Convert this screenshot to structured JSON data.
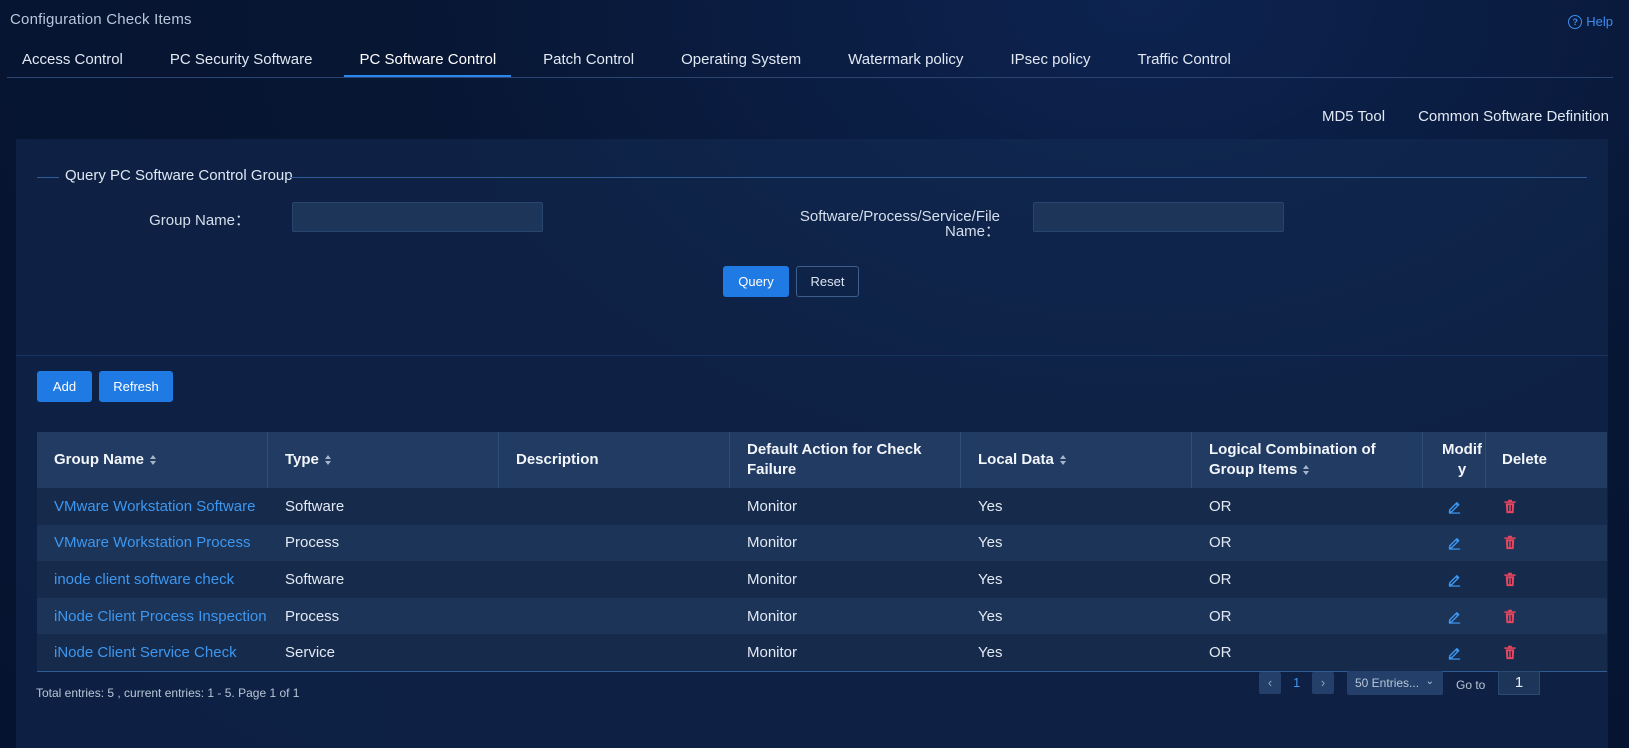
{
  "page": {
    "title": "Configuration Check Items",
    "help_label": "Help"
  },
  "tabs": [
    {
      "label": "Access Control"
    },
    {
      "label": "PC Security Software"
    },
    {
      "label": "PC Software Control",
      "active": true
    },
    {
      "label": "Patch Control"
    },
    {
      "label": "Operating System"
    },
    {
      "label": "Watermark policy"
    },
    {
      "label": "IPsec policy"
    },
    {
      "label": "Traffic Control"
    }
  ],
  "toplinks": {
    "md5_tool": "MD5 Tool",
    "common_software": "Common Software Definition"
  },
  "query": {
    "title": "Query PC Software Control Group",
    "group_name_label": "Group Name：",
    "group_name_value": "",
    "software_label_line1": "Software/Process/Service/File",
    "software_label_line2": "Name：",
    "software_value": "",
    "query_button": "Query",
    "reset_button": "Reset"
  },
  "actions": {
    "add": "Add",
    "refresh": "Refresh"
  },
  "table": {
    "headers": {
      "group_name": "Group Name",
      "type": "Type",
      "description": "Description",
      "default_action": "Default Action for Check Failure",
      "local_data": "Local Data",
      "logical": "Logical Combination of Group Items",
      "modify": "Modify",
      "delete": "Delete"
    },
    "rows": [
      {
        "group_name": "VMware Workstation Software",
        "type": "Software",
        "description": "",
        "default_action": "Monitor",
        "local_data": "Yes",
        "logical": "OR"
      },
      {
        "group_name": "VMware Workstation Process",
        "type": "Process",
        "description": "",
        "default_action": "Monitor",
        "local_data": "Yes",
        "logical": "OR"
      },
      {
        "group_name": "inode client software check",
        "type": "Software",
        "description": "",
        "default_action": "Monitor",
        "local_data": "Yes",
        "logical": "OR"
      },
      {
        "group_name": "iNode Client Process Inspection",
        "type": "Process",
        "description": "",
        "default_action": "Monitor",
        "local_data": "Yes",
        "logical": "OR"
      },
      {
        "group_name": "iNode Client Service Check",
        "type": "Service",
        "description": "",
        "default_action": "Monitor",
        "local_data": "Yes",
        "logical": "OR"
      }
    ]
  },
  "footer": {
    "summary": "Total entries: 5 , current entries: 1 - 5. Page 1 of 1",
    "prev": "‹",
    "page": "1",
    "next": "›",
    "page_size": "50 Entries...",
    "goto_label": "Go to",
    "goto_value": "1"
  },
  "colors": {
    "accent": "#1f7ae3",
    "link": "#3d97f0",
    "delete": "#e8465f"
  },
  "icons": {
    "help": "help-circle-icon",
    "modify": "pencil-icon",
    "delete": "trash-icon",
    "sort": "sort-caret-icon"
  }
}
